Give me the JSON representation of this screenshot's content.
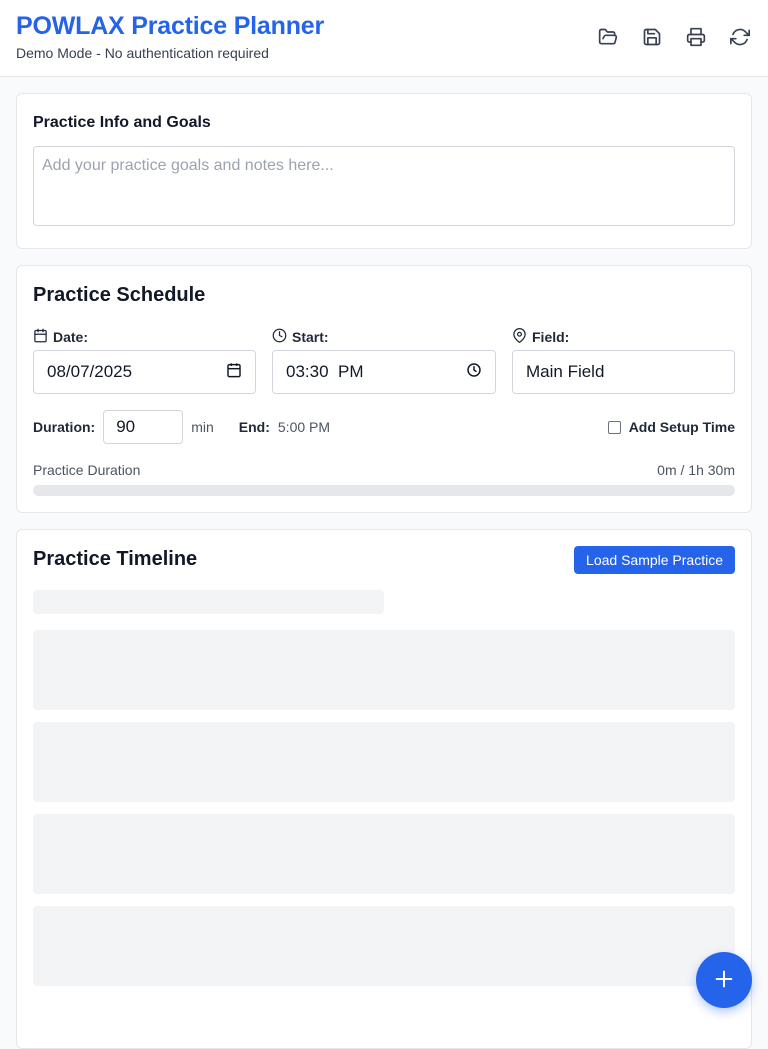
{
  "header": {
    "title": "POWLAX Practice Planner",
    "subtitle": "Demo Mode - No authentication required",
    "tools": [
      "folder-open-icon",
      "save-icon",
      "print-icon",
      "refresh-icon"
    ]
  },
  "info_card": {
    "label": "Practice Info and Goals",
    "goals_placeholder": "Add your practice goals and notes here...",
    "goals_value": ""
  },
  "schedule": {
    "heading": "Practice Schedule",
    "date_label": "Date:",
    "date_value": "08/07/2025",
    "start_label": "Start:",
    "start_value": "03:30  PM",
    "field_label": "Field:",
    "field_value": "Main Field",
    "duration_label": "Duration:",
    "duration_value": "90",
    "duration_unit": "min",
    "end_label": "End:",
    "end_value": "5:00 PM",
    "setup_label": "Add Setup Time",
    "setup_checked": false,
    "progress_label": "Practice Duration",
    "progress_value": "0m / 1h 30m",
    "progress_fraction": 0
  },
  "timeline": {
    "heading": "Practice Timeline",
    "load_label": "Load Sample Practice"
  },
  "colors": {
    "accent": "#2563eb",
    "skeleton": "#f3f4f6"
  }
}
